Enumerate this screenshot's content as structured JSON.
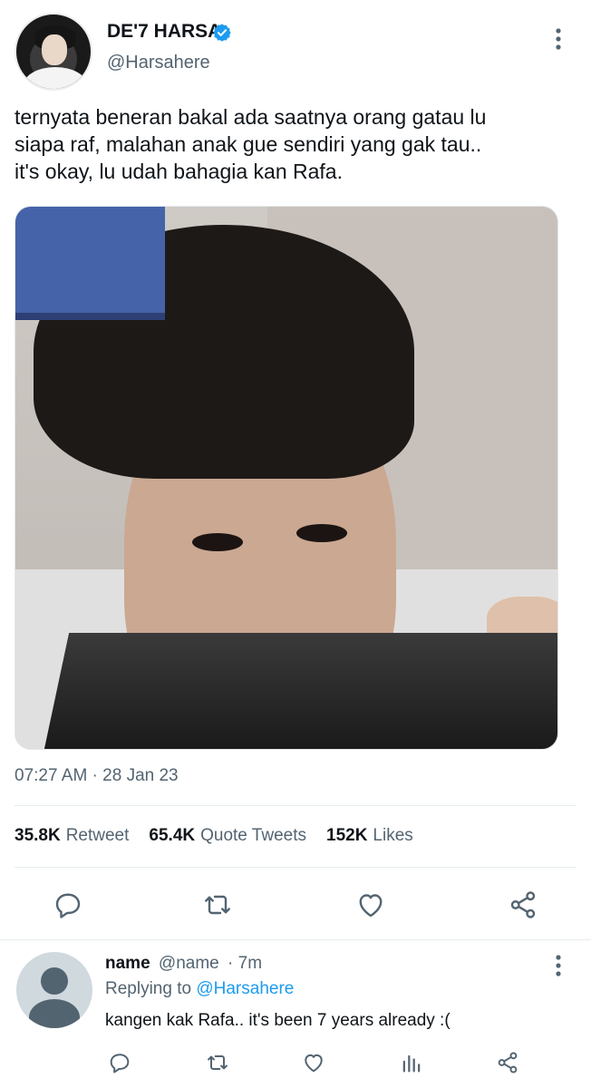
{
  "tweet": {
    "display_name": "DE'7 HARSA",
    "handle": "@Harsahere",
    "text_lines": [
      "ternyata beneran bakal ada saatnya orang gatau lu",
      "siapa raf, malahan anak gue sendiri yang gak tau..",
      "it's okay, lu udah bahagia kan Rafa."
    ],
    "timestamp": "07:27 AM · 28 Jan 23",
    "stats": [
      {
        "value": "35.8K",
        "label": "Retweet"
      },
      {
        "value": "65.4K",
        "label": "Quote Tweets"
      },
      {
        "value": "152K",
        "label": "Likes"
      }
    ],
    "icons": {
      "more": "more-vertical-icon",
      "verified": "verified-badge-icon",
      "reply": "reply-icon",
      "retweet": "retweet-icon",
      "like": "heart-icon",
      "share": "share-icon"
    },
    "colors": {
      "accent": "#1d9bf0",
      "text": "#0f1419",
      "muted": "#536471"
    }
  },
  "reply": {
    "name": "name",
    "handle": "@name",
    "time": "· 7m",
    "replying_prefix": "Replying to ",
    "replying_to": "@Harsahere",
    "text": "kangen kak Rafa.. it's been 7 years already :("
  }
}
